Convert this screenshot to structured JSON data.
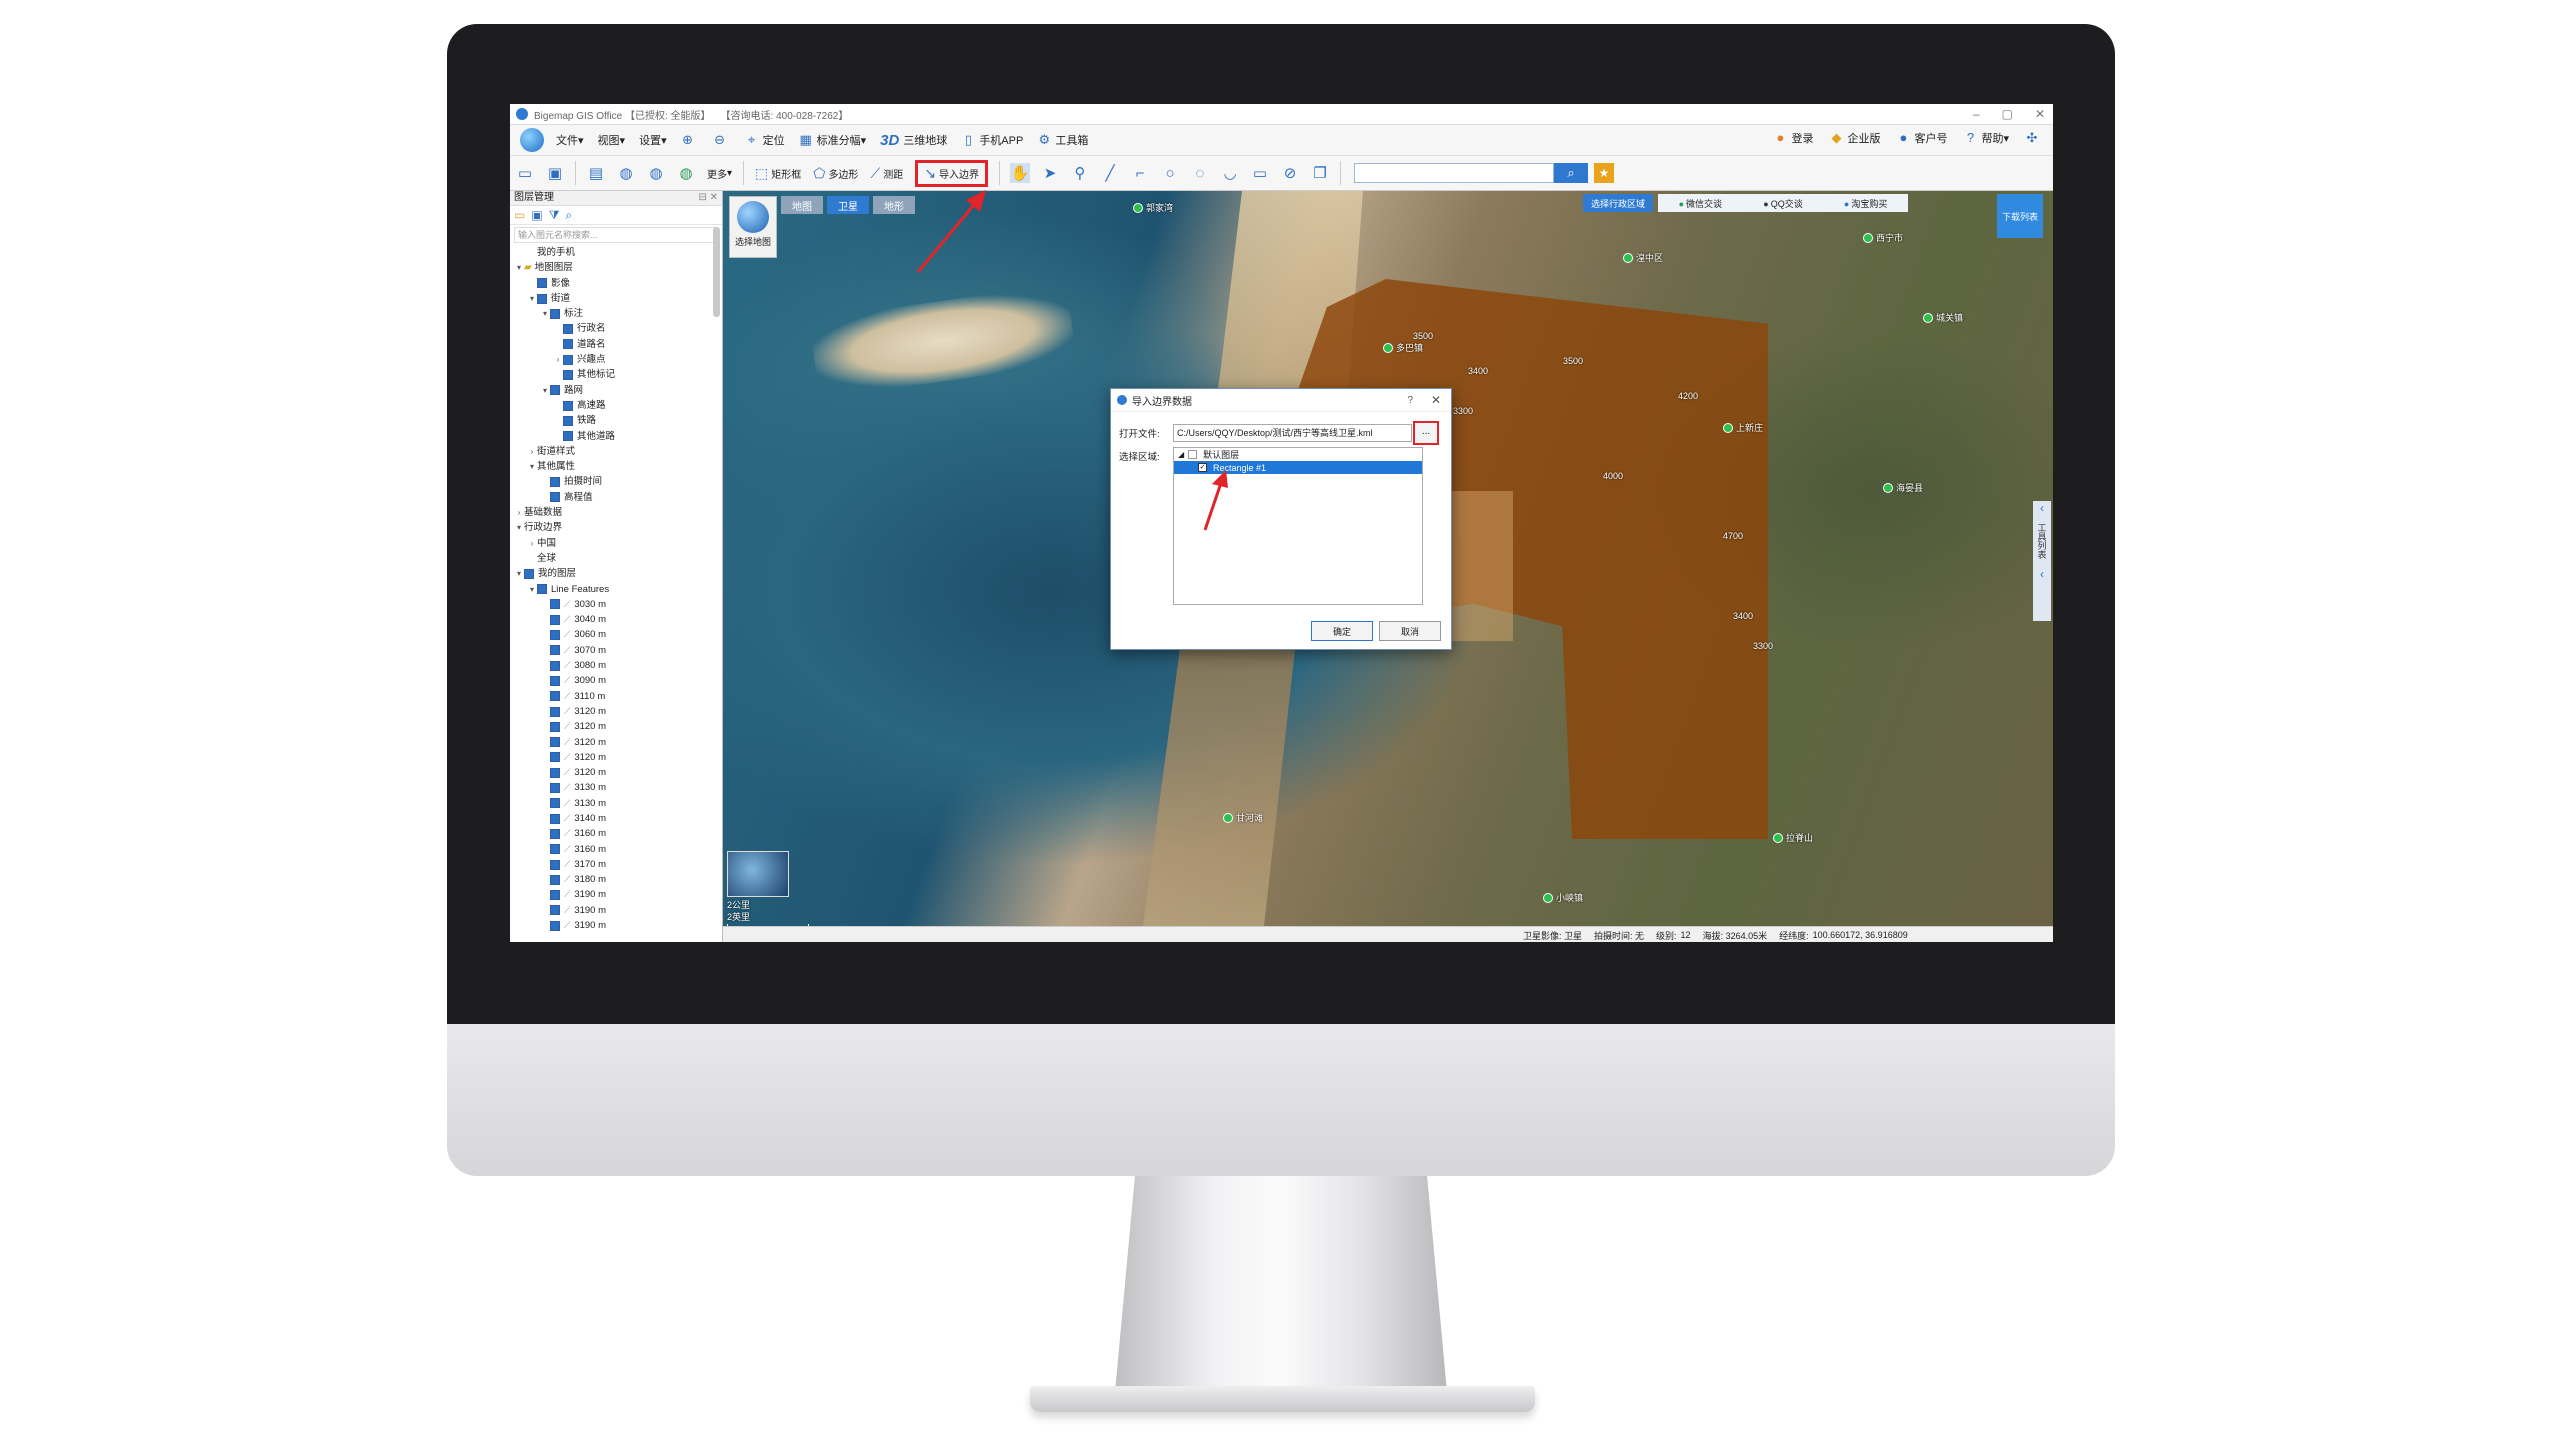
{
  "window": {
    "title": "Bigemap GIS Office 【已授权: 全能版】",
    "hotline": "【咨询电话: 400-028-7262】"
  },
  "menu": {
    "items": [
      {
        "label": "文件",
        "icon": "file-icon"
      },
      {
        "label": "视图",
        "icon": "view-icon"
      },
      {
        "label": "设置",
        "icon": "settings-icon"
      },
      {
        "label": "定位",
        "icon": "locate-icon"
      },
      {
        "label": "标准分幅",
        "icon": "grid-icon"
      },
      {
        "label": "三维地球",
        "icon": "3d-icon"
      },
      {
        "label": "手机APP",
        "icon": "phone-icon"
      },
      {
        "label": "工具箱",
        "icon": "toolbox-icon"
      }
    ],
    "right": [
      {
        "label": "登录",
        "icon": "user-icon"
      },
      {
        "label": "企业版",
        "icon": "enterprise-icon"
      },
      {
        "label": "客户号",
        "icon": "customer-icon"
      },
      {
        "label": "帮助",
        "icon": "help-icon"
      }
    ]
  },
  "toolbar": {
    "more": "更多",
    "rectangle": "矩形框",
    "polygon": "多边形",
    "measure": "测距",
    "import_boundary": "导入边界"
  },
  "panel": {
    "title": "图层管理",
    "search_placeholder": "输入图元名称搜索...",
    "tree": [
      {
        "label": "我的手机",
        "indent": 1,
        "toggle": "",
        "check": "none"
      },
      {
        "label": "地图图层",
        "indent": 0,
        "toggle": "▾",
        "check": "folder"
      },
      {
        "label": "影像",
        "indent": 1,
        "toggle": "",
        "check": "on"
      },
      {
        "label": "街道",
        "indent": 1,
        "toggle": "▾",
        "check": "on"
      },
      {
        "label": "标注",
        "indent": 2,
        "toggle": "▾",
        "check": "on"
      },
      {
        "label": "行政名",
        "indent": 3,
        "toggle": "",
        "check": "on"
      },
      {
        "label": "道路名",
        "indent": 3,
        "toggle": "",
        "check": "on"
      },
      {
        "label": "兴趣点",
        "indent": 3,
        "toggle": "›",
        "check": "on"
      },
      {
        "label": "其他标记",
        "indent": 3,
        "toggle": "",
        "check": "on"
      },
      {
        "label": "路网",
        "indent": 2,
        "toggle": "▾",
        "check": "on"
      },
      {
        "label": "高速路",
        "indent": 3,
        "toggle": "",
        "check": "on"
      },
      {
        "label": "铁路",
        "indent": 3,
        "toggle": "",
        "check": "on"
      },
      {
        "label": "其他道路",
        "indent": 3,
        "toggle": "",
        "check": "on"
      },
      {
        "label": "街道样式",
        "indent": 1,
        "toggle": "›",
        "check": "none"
      },
      {
        "label": "其他属性",
        "indent": 1,
        "toggle": "▾",
        "check": "none"
      },
      {
        "label": "拍摄时间",
        "indent": 2,
        "toggle": "",
        "check": "on"
      },
      {
        "label": "高程值",
        "indent": 2,
        "toggle": "",
        "check": "on"
      },
      {
        "label": "基础数据",
        "indent": 0,
        "toggle": "›",
        "check": "none"
      },
      {
        "label": "行政边界",
        "indent": 0,
        "toggle": "▾",
        "check": "none"
      },
      {
        "label": "中国",
        "indent": 1,
        "toggle": "›",
        "check": "none"
      },
      {
        "label": "全球",
        "indent": 1,
        "toggle": "",
        "check": "none"
      },
      {
        "label": "我的图层",
        "indent": 0,
        "toggle": "▾",
        "check": "on"
      },
      {
        "label": "Line Features",
        "indent": 1,
        "toggle": "▾",
        "check": "on"
      },
      {
        "label": "3030 m",
        "indent": 2,
        "toggle": "",
        "check": "line"
      },
      {
        "label": "3040 m",
        "indent": 2,
        "toggle": "",
        "check": "line"
      },
      {
        "label": "3060 m",
        "indent": 2,
        "toggle": "",
        "check": "line"
      },
      {
        "label": "3070 m",
        "indent": 2,
        "toggle": "",
        "check": "line"
      },
      {
        "label": "3080 m",
        "indent": 2,
        "toggle": "",
        "check": "line"
      },
      {
        "label": "3090 m",
        "indent": 2,
        "toggle": "",
        "check": "line"
      },
      {
        "label": "3110 m",
        "indent": 2,
        "toggle": "",
        "check": "line"
      },
      {
        "label": "3120 m",
        "indent": 2,
        "toggle": "",
        "check": "line"
      },
      {
        "label": "3120 m",
        "indent": 2,
        "toggle": "",
        "check": "line"
      },
      {
        "label": "3120 m",
        "indent": 2,
        "toggle": "",
        "check": "line"
      },
      {
        "label": "3120 m",
        "indent": 2,
        "toggle": "",
        "check": "line"
      },
      {
        "label": "3120 m",
        "indent": 2,
        "toggle": "",
        "check": "line"
      },
      {
        "label": "3130 m",
        "indent": 2,
        "toggle": "",
        "check": "line"
      },
      {
        "label": "3130 m",
        "indent": 2,
        "toggle": "",
        "check": "line"
      },
      {
        "label": "3140 m",
        "indent": 2,
        "toggle": "",
        "check": "line"
      },
      {
        "label": "3160 m",
        "indent": 2,
        "toggle": "",
        "check": "line"
      },
      {
        "label": "3160 m",
        "indent": 2,
        "toggle": "",
        "check": "line"
      },
      {
        "label": "3170 m",
        "indent": 2,
        "toggle": "",
        "check": "line"
      },
      {
        "label": "3180 m",
        "indent": 2,
        "toggle": "",
        "check": "line"
      },
      {
        "label": "3190 m",
        "indent": 2,
        "toggle": "",
        "check": "line"
      },
      {
        "label": "3190 m",
        "indent": 2,
        "toggle": "",
        "check": "line"
      },
      {
        "label": "3190 m",
        "indent": 2,
        "toggle": "",
        "check": "line"
      }
    ]
  },
  "map": {
    "tabs": [
      "地图",
      "卫星",
      "地形"
    ],
    "active_tab": "卫星",
    "choose_map": "选择地图",
    "admin_region": "选择行政区域",
    "wechat": "微信交谈",
    "qq": "QQ交谈",
    "taobao": "淘宝购买",
    "download_list": "下载列表",
    "tool_list": "工具列表",
    "scale_km": "2公里",
    "scale_mi": "2英里",
    "contour_labels": [
      "3500",
      "3400",
      "3300",
      "3500",
      "4000",
      "4200",
      "4700",
      "3400",
      "3300"
    ],
    "pois": [
      "郭家湾",
      "西宁市",
      "湟中区",
      "城关镇",
      "多巴镇",
      "上新庄",
      "海晏县",
      "甘河滩",
      "小峡镇",
      "拉脊山"
    ]
  },
  "statusbar": {
    "source": "卫星影像: 卫星",
    "time": "拍摄时间: 无",
    "level_label": "级别:",
    "level": "12",
    "altitude": "海拔: 3264.05米",
    "coords_label": "经纬度:",
    "coords": "100.660172, 36.916809"
  },
  "dialog": {
    "title": "导入边界数据",
    "help": "?",
    "open_file_label": "打开文件:",
    "file_path": "C:/Users/QQY/Desktop/测试/西宁等高线卫星.kml",
    "browse": "...",
    "region_label": "选择区域:",
    "default_layer": "默认图层",
    "selected_item": "Rectangle #1",
    "ok": "确定",
    "cancel": "取消"
  },
  "annotation_color": "#e0242a"
}
